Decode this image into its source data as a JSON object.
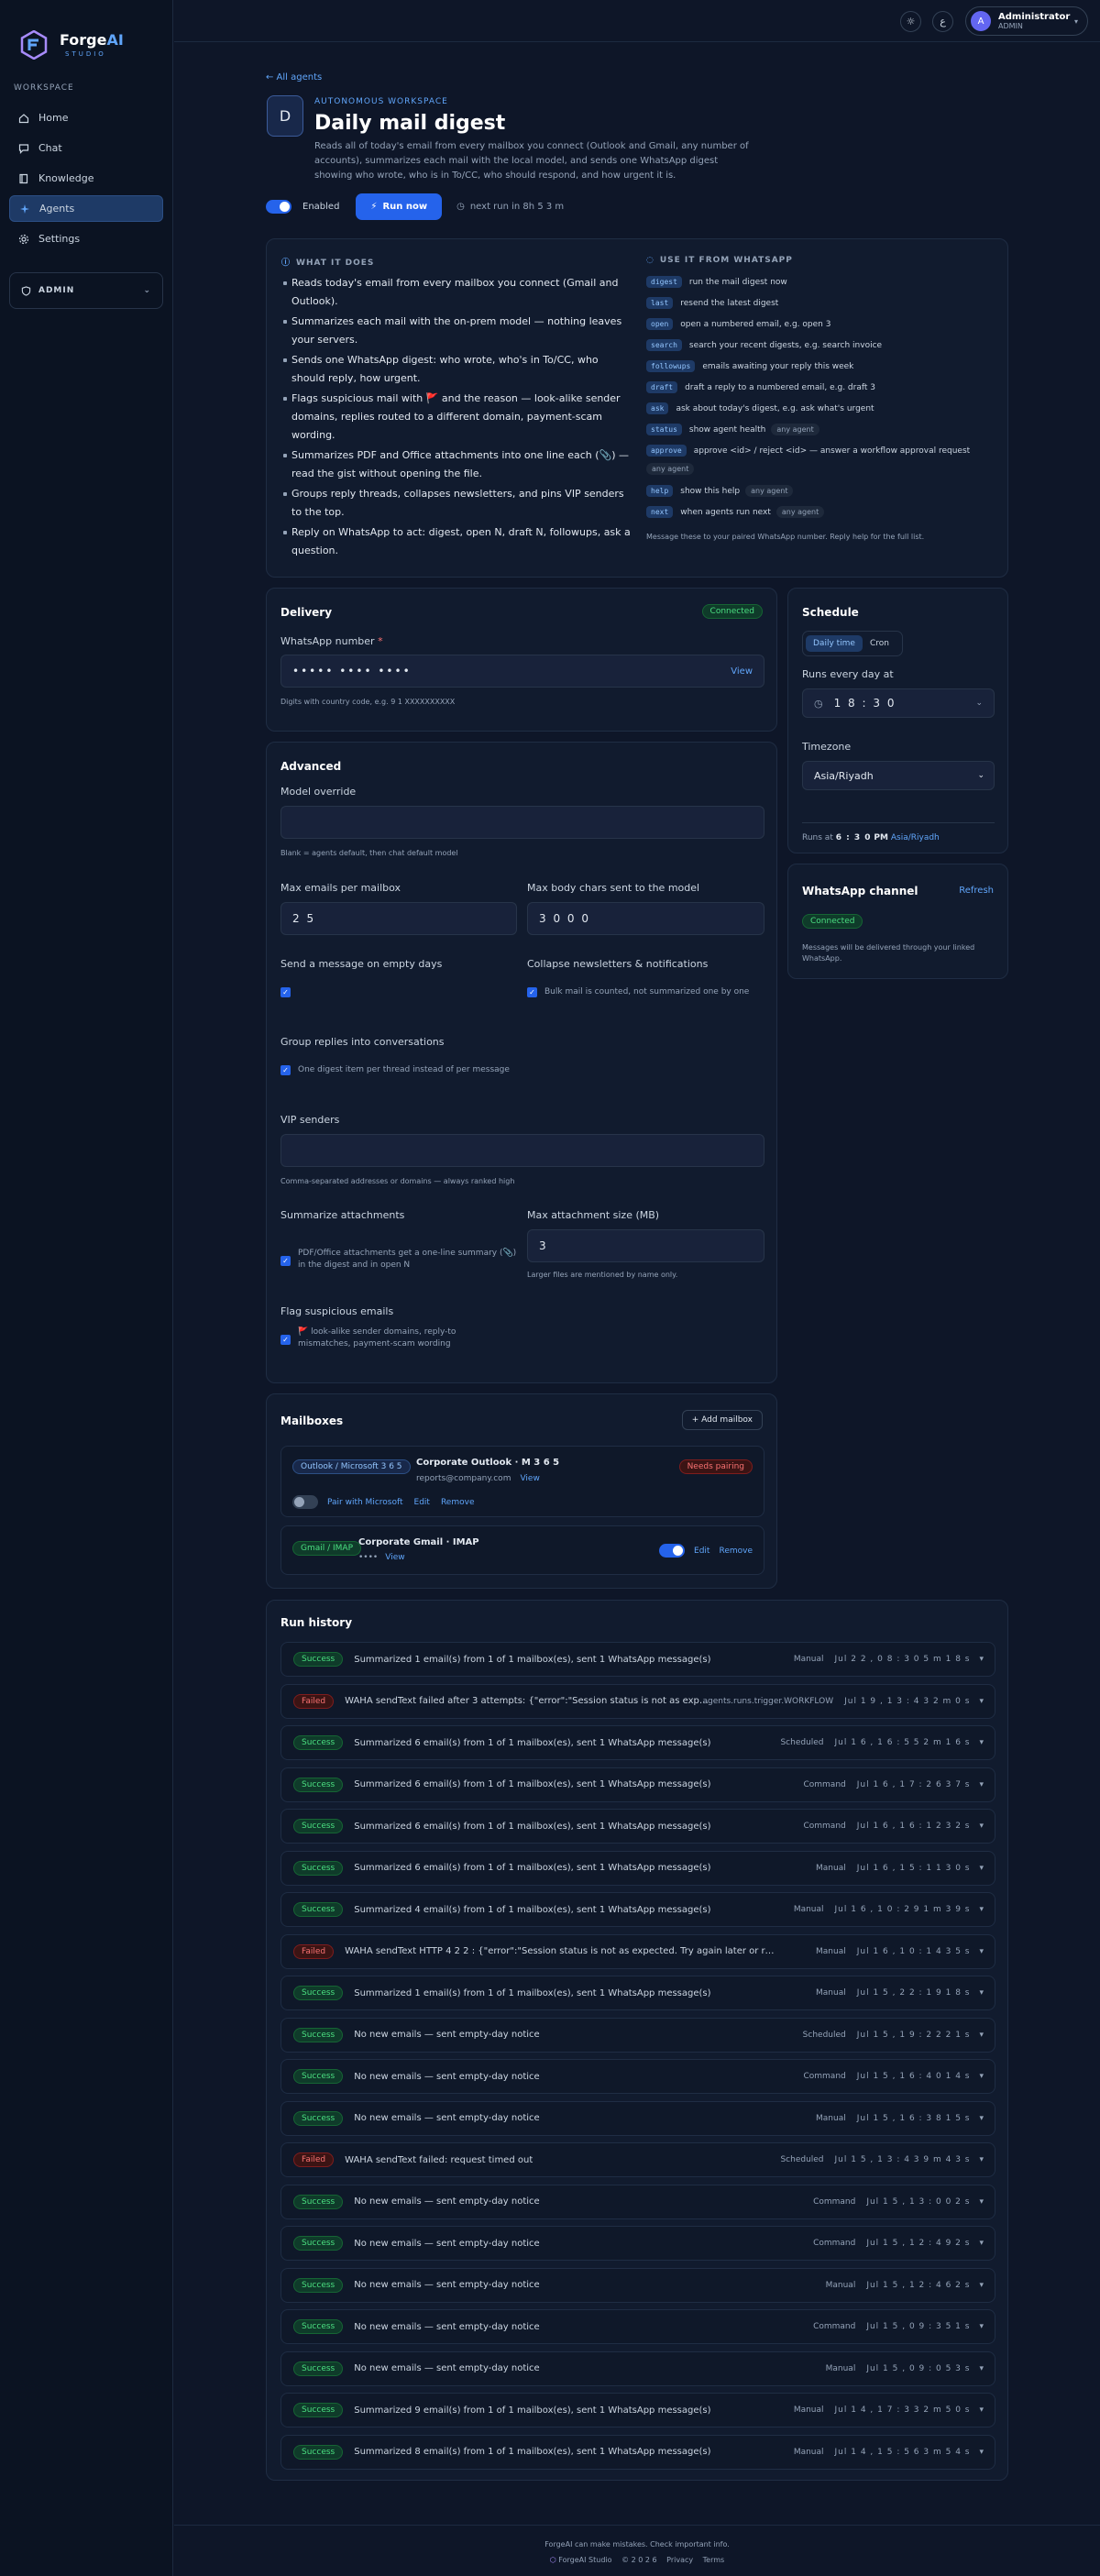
{
  "brand": {
    "name_a": "Forge",
    "name_b": "AI",
    "sub": "STUDIO"
  },
  "sidebar": {
    "section": "WORKSPACE",
    "items": [
      {
        "label": "Home",
        "icon": "home-icon"
      },
      {
        "label": "Chat",
        "icon": "chat-icon"
      },
      {
        "label": "Knowledge",
        "icon": "book-icon"
      },
      {
        "label": "Agents",
        "icon": "sparkle-icon",
        "active": true
      },
      {
        "label": "Settings",
        "icon": "gear-icon"
      }
    ],
    "admin": "ADMIN"
  },
  "topbar": {
    "user": {
      "initial": "A",
      "name": "Administrator",
      "role": "ADMIN"
    }
  },
  "header": {
    "back": "← All agents",
    "avatar": "D",
    "eyebrow": "AUTONOMOUS WORKSPACE",
    "title": "Daily mail digest",
    "description": "Reads all of today's email from every mailbox you connect (Outlook and Gmail, any number of accounts), summarizes each mail with the local model, and sends one WhatsApp digest showing who wrote, who is in To/CC, who should respond, and how urgent it is.",
    "enabled_label": "Enabled",
    "run_label": "Run now",
    "next_run": "next run in 8h 5 3 m"
  },
  "what_it_does": {
    "title": "WHAT IT DOES",
    "bullets": [
      "Reads today's email from every mailbox you connect (Gmail and Outlook).",
      "Summarizes each mail with the on-prem model — nothing leaves your servers.",
      "Sends one WhatsApp digest: who wrote, who's in To/CC, who should reply, how urgent.",
      "Flags suspicious mail with 🚩 and the reason — look-alike sender domains, replies routed to a different domain, payment-scam wording.",
      "Summarizes PDF and Office attachments into one line each (📎) — read the gist without opening the file.",
      "Groups reply threads, collapses newsletters, and pins VIP senders to the top.",
      "Reply on WhatsApp to act: digest, open N, draft N, followups, ask a question."
    ]
  },
  "use_it": {
    "title": "USE IT FROM WHATSAPP",
    "commands": [
      {
        "cmd": "digest",
        "desc": "run the mail digest now",
        "tag": ""
      },
      {
        "cmd": "last",
        "desc": "resend the latest digest",
        "tag": ""
      },
      {
        "cmd": "open",
        "desc": "open a numbered email, e.g. open 3",
        "tag": ""
      },
      {
        "cmd": "search",
        "desc": "search your recent digests, e.g. search invoice",
        "tag": ""
      },
      {
        "cmd": "followups",
        "desc": "emails awaiting your reply this week",
        "tag": ""
      },
      {
        "cmd": "draft",
        "desc": "draft a reply to a numbered email, e.g. draft 3",
        "tag": ""
      },
      {
        "cmd": "ask",
        "desc": "ask about today's digest, e.g. ask what's urgent",
        "tag": ""
      },
      {
        "cmd": "status",
        "desc": "show agent health",
        "tag": "any agent"
      },
      {
        "cmd": "approve",
        "desc": "approve <id> / reject <id> — answer a workflow approval request",
        "tag": ""
      },
      {
        "cmd": "help",
        "desc": "show this help",
        "tag": "any agent"
      },
      {
        "cmd": "next",
        "desc": "when agents run next",
        "tag": "any agent"
      }
    ],
    "extra_tag": "any agent",
    "footnote": "Message these to your paired WhatsApp number. Reply help for the full list."
  },
  "delivery": {
    "title": "Delivery",
    "status": "Connected",
    "label": "WhatsApp number",
    "required": "*",
    "value": "••••• •••• ••••",
    "view": "View",
    "help": "Digits with country code, e.g. 9 1 XXXXXXXXXX"
  },
  "schedule": {
    "title": "Schedule",
    "tabs": [
      "Daily time",
      "Cron"
    ],
    "runs_label": "Runs every day at",
    "time": "1 8 : 3 0",
    "tz_label": "Timezone",
    "tz": "Asia/Riyadh",
    "runs_at_prefix": "Runs at",
    "runs_at_time": "6 : 3 0",
    "runs_at_pm": "PM",
    "runs_at_tz": "Asia/Riyadh"
  },
  "whatsapp": {
    "title": "WhatsApp channel",
    "refresh": "Refresh",
    "status": "Connected",
    "desc": "Messages will be delivered through your linked WhatsApp."
  },
  "advanced": {
    "title": "Advanced",
    "model_label": "Model override",
    "model_value": "",
    "model_help": "Blank = agents default, then chat default model",
    "max_emails_label": "Max emails per mailbox",
    "max_emails": "2 5",
    "max_chars_label": "Max body chars sent to the model",
    "max_chars": "3 0 0 0",
    "empty_days_label": "Send a message on empty days",
    "collapse_label": "Collapse newsletters & notifications",
    "collapse_help": "Bulk mail is counted, not summarized one by one",
    "group_label": "Group replies into conversations",
    "group_help": "One digest item per thread instead of per message",
    "vip_label": "VIP senders",
    "vip_value": "",
    "vip_help": "Comma-separated addresses or domains — always ranked high",
    "attach_label": "Summarize attachments",
    "attach_help": "PDF/Office attachments get a one-line summary (📎) in the digest and in open N",
    "max_attach_label": "Max attachment size (MB)",
    "max_attach": "3",
    "max_attach_help": "Larger files are mentioned by name only.",
    "flag_label": "Flag suspicious emails",
    "flag_help": "🚩 look-alike sender domains, reply-to mismatches, payment-scam wording"
  },
  "mailboxes": {
    "title": "Mailboxes",
    "add": "+ Add mailbox",
    "items": [
      {
        "provider": "Outlook / Microsoft 3 6 5",
        "name": "Corporate Outlook · M 3 6 5",
        "email": "reports@company.com",
        "view": "View",
        "status": "Needs pairing",
        "pair": "Pair with Microsoft",
        "edit": "Edit",
        "remove": "Remove"
      },
      {
        "provider": "Gmail / IMAP",
        "name": "Corporate Gmail · IMAP",
        "email": "••••",
        "view": "View",
        "edit": "Edit",
        "remove": "Remove"
      }
    ]
  },
  "history": {
    "title": "Run history",
    "rows": [
      {
        "status": "Success",
        "msg": "Summarized 1 email(s) from 1 of 1 mailbox(es), sent 1 WhatsApp message(s)",
        "trigger": "Manual",
        "when": "Jul 2 2 , 0 8 : 3 0   5 m 1 8 s"
      },
      {
        "status": "Failed",
        "msg": "WAHA sendText failed after 3 attempts: {\"error\":\"Session status is not as expecte...",
        "trigger": "agents.runs.trigger.WORKFLOW",
        "when": "Jul 1 9 , 1 3 : 4 3   2 m 0 s"
      },
      {
        "status": "Success",
        "msg": "Summarized 6 email(s) from 1 of 1 mailbox(es), sent 1 WhatsApp message(s)",
        "trigger": "Scheduled",
        "when": "Jul 1 6 , 1 6 : 5 5   2 m 1 6 s"
      },
      {
        "status": "Success",
        "msg": "Summarized 6 email(s) from 1 of 1 mailbox(es), sent 1 WhatsApp message(s)",
        "trigger": "Command",
        "when": "Jul 1 6 , 1 7 : 2 6   3 7 s"
      },
      {
        "status": "Success",
        "msg": "Summarized 6 email(s) from 1 of 1 mailbox(es), sent 1 WhatsApp message(s)",
        "trigger": "Command",
        "when": "Jul 1 6 , 1 6 : 1 2   3 2 s"
      },
      {
        "status": "Success",
        "msg": "Summarized 6 email(s) from 1 of 1 mailbox(es), sent 1 WhatsApp message(s)",
        "trigger": "Manual",
        "when": "Jul 1 6 , 1 5 : 1 1   3 0 s"
      },
      {
        "status": "Success",
        "msg": "Summarized 4 email(s) from 1 of 1 mailbox(es), sent 1 WhatsApp message(s)",
        "trigger": "Manual",
        "when": "Jul 1 6 , 1 0 : 2 9   1 m 3 9 s"
      },
      {
        "status": "Failed",
        "msg": "WAHA sendText HTTP 4 2 2 : {\"error\":\"Session status is not as expected. Try again later or restart the ses...",
        "trigger": "Manual",
        "when": "Jul 1 6 , 1 0 : 1 4   3 5 s"
      },
      {
        "status": "Success",
        "msg": "Summarized 1 email(s) from 1 of 1 mailbox(es), sent 1 WhatsApp message(s)",
        "trigger": "Manual",
        "when": "Jul 1 5 , 2 2 : 1 9   1 8 s"
      },
      {
        "status": "Success",
        "msg": "No new emails — sent empty-day notice",
        "trigger": "Scheduled",
        "when": "Jul 1 5 , 1 9 : 2 2   2 1 s"
      },
      {
        "status": "Success",
        "msg": "No new emails — sent empty-day notice",
        "trigger": "Command",
        "when": "Jul 1 5 , 1 6 : 4 0   1 4 s"
      },
      {
        "status": "Success",
        "msg": "No new emails — sent empty-day notice",
        "trigger": "Manual",
        "when": "Jul 1 5 , 1 6 : 3 8   1 5 s"
      },
      {
        "status": "Failed",
        "msg": "WAHA sendText failed: request timed out",
        "trigger": "Scheduled",
        "when": "Jul 1 5 , 1 3 : 4 3   9 m 4 3 s"
      },
      {
        "status": "Success",
        "msg": "No new emails — sent empty-day notice",
        "trigger": "Command",
        "when": "Jul 1 5 , 1 3 : 0 0   2 s"
      },
      {
        "status": "Success",
        "msg": "No new emails — sent empty-day notice",
        "trigger": "Command",
        "when": "Jul 1 5 , 1 2 : 4 9   2 s"
      },
      {
        "status": "Success",
        "msg": "No new emails — sent empty-day notice",
        "trigger": "Manual",
        "when": "Jul 1 5 , 1 2 : 4 6   2 s"
      },
      {
        "status": "Success",
        "msg": "No new emails — sent empty-day notice",
        "trigger": "Command",
        "when": "Jul 1 5 , 0 9 : 3 5   1 s"
      },
      {
        "status": "Success",
        "msg": "No new emails — sent empty-day notice",
        "trigger": "Manual",
        "when": "Jul 1 5 , 0 9 : 0 5   3 s"
      },
      {
        "status": "Success",
        "msg": "Summarized 9 email(s) from 1 of 1 mailbox(es), sent 1 WhatsApp message(s)",
        "trigger": "Manual",
        "when": "Jul 1 4 , 1 7 : 3 3   2 m 5 0 s"
      },
      {
        "status": "Success",
        "msg": "Summarized 8 email(s) from 1 of 1 mailbox(es), sent 1 WhatsApp message(s)",
        "trigger": "Manual",
        "when": "Jul 1 4 , 1 5 : 5 6   3 m 5 4 s"
      }
    ]
  },
  "footer": {
    "disclaimer": "ForgeAI can make mistakes. Check important info.",
    "brand": "ForgeAI Studio",
    "year": "© 2 0 2 6",
    "privacy": "Privacy",
    "terms": "Terms"
  }
}
